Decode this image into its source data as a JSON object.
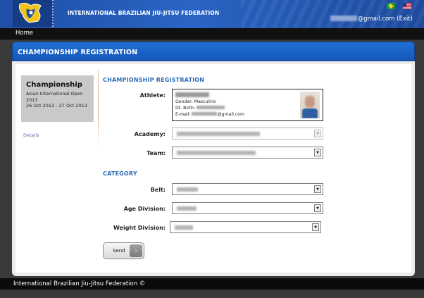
{
  "header": {
    "org_name": "INTERNATIONAL BRAZILIAN JIU-JITSU FEDERATION",
    "user_email_suffix": "@gmail.com",
    "exit_label": "(Exit)",
    "flags": [
      "brazil-flag-icon",
      "usa-flag-icon"
    ]
  },
  "nav": {
    "home": "Home"
  },
  "page": {
    "title": "CHAMPIONSHIP REGISTRATION"
  },
  "sidebar": {
    "heading": "Championship",
    "event_name": "Asian International Open 2013",
    "event_dates": "26 Oct 2013 - 27 Oct 2013",
    "details_link": "Details"
  },
  "form": {
    "section_registration": "CHAMPIONSHIP REGISTRATION",
    "athlete_label": "Athlete:",
    "athlete": {
      "gender_label": "Gender:",
      "gender_value": "Masculino",
      "birth_label": "Dt. Birth:",
      "email_label": "E-mail:",
      "email_suffix": "@gmail.com"
    },
    "academy_label": "Academy:",
    "team_label": "Team:",
    "section_category": "CATEGORY",
    "belt_label": "Belt:",
    "age_label": "Age Division:",
    "weight_label": "Weight Division:",
    "send_label": "Send"
  },
  "footer": {
    "text": "International Brazilian Jiu-Jitsu Federation ©"
  },
  "colors": {
    "header_blue": "#1f5fc0",
    "section_title": "#2a6bb7",
    "link": "#6b6bb7"
  }
}
